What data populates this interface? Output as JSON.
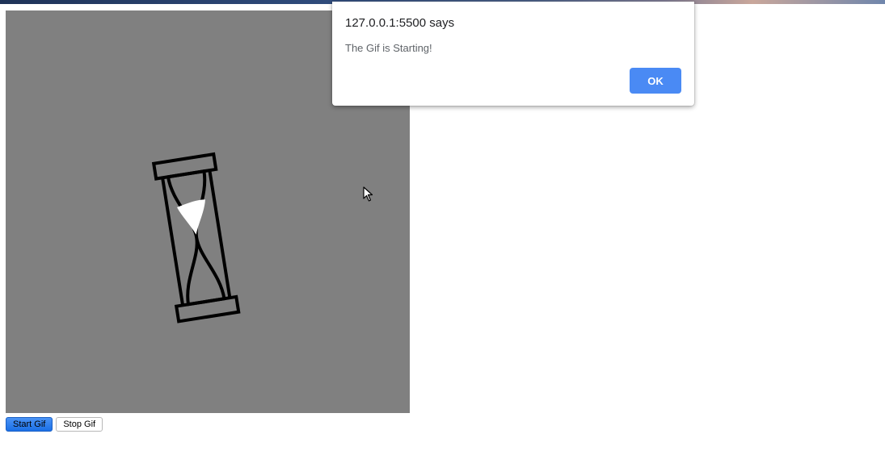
{
  "gif": {
    "icon": "hourglass-icon",
    "background_color": "#808080"
  },
  "controls": {
    "start_label": "Start Gif",
    "stop_label": "Stop Gif"
  },
  "alert": {
    "title": "127.0.0.1:5500 says",
    "message": "The Gif is Starting!",
    "ok_label": "OK",
    "accent_color": "#4a8af4"
  },
  "cursor": {
    "icon": "mouse-pointer-icon"
  }
}
